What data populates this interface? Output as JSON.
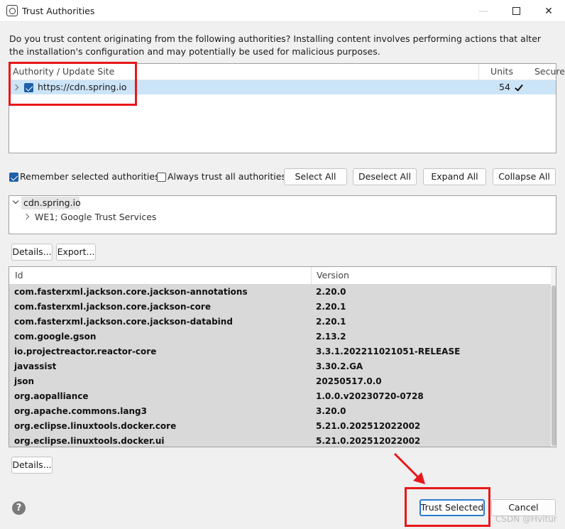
{
  "window": {
    "title": "Trust Authorities",
    "minimize_glyph": "—",
    "close_glyph": "✕"
  },
  "intro_text": "Do you trust content originating from the following authorities?  Installing content involves performing actions that alter the installation's configuration and may potentially be used for malicious purposes.",
  "authorities_table": {
    "columns": [
      "Authority / Update Site",
      "Units",
      "Secured"
    ],
    "rows": [
      {
        "url": "https://cdn.spring.io",
        "units": "54",
        "secured": true,
        "checked": true,
        "selected": true
      }
    ]
  },
  "options": {
    "remember_label": "Remember selected authorities",
    "remember_checked": true,
    "always_trust_label": "Always trust all authorities",
    "always_trust_checked": false
  },
  "buttons": {
    "select_all": "Select All",
    "deselect_all": "Deselect All",
    "expand_all": "Expand All",
    "collapse_all": "Collapse All",
    "details": "Details...",
    "export": "Export...",
    "details2": "Details...",
    "trust_selected": "Trust Selected",
    "cancel": "Cancel"
  },
  "certificate_tree": {
    "root": "cdn.spring.io",
    "child": "WE1; Google Trust Services"
  },
  "ids_table": {
    "columns": [
      "Id",
      "Version"
    ],
    "rows": [
      {
        "id": "com.fasterxml.jackson.core.jackson-annotations",
        "version": "2.20.0"
      },
      {
        "id": "com.fasterxml.jackson.core.jackson-core",
        "version": "2.20.1"
      },
      {
        "id": "com.fasterxml.jackson.core.jackson-databind",
        "version": "2.20.1"
      },
      {
        "id": "com.google.gson",
        "version": "2.13.2"
      },
      {
        "id": "io.projectreactor.reactor-core",
        "version": "3.3.1.202211021051-RELEASE"
      },
      {
        "id": "javassist",
        "version": "3.30.2.GA"
      },
      {
        "id": "json",
        "version": "20250517.0.0"
      },
      {
        "id": "org.aopalliance",
        "version": "1.0.0.v20230720-0728"
      },
      {
        "id": "org.apache.commons.lang3",
        "version": "3.20.0"
      },
      {
        "id": "org.eclipse.linuxtools.docker.core",
        "version": "5.21.0.202512022002"
      },
      {
        "id": "org.eclipse.linuxtools.docker.ui",
        "version": "5.21.0.202512022002"
      }
    ]
  },
  "help_glyph": "?",
  "watermark": "CSDN @Hvitur",
  "colors": {
    "selection": "#cce4f7",
    "annotation_red": "#e8171b",
    "checkbox_blue": "#1e5fa8"
  }
}
